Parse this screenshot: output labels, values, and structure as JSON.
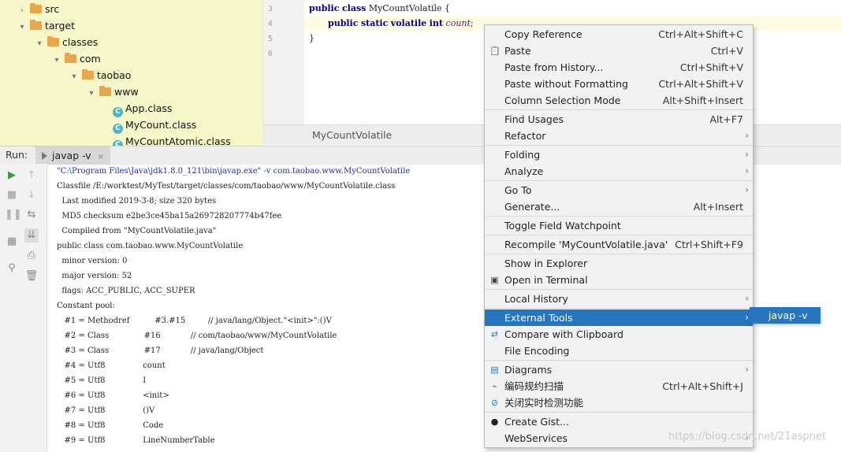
{
  "project_tree": {
    "items": [
      {
        "label": "src",
        "depth": 0,
        "expanded": false,
        "type": "folder"
      },
      {
        "label": "target",
        "depth": 0,
        "expanded": true,
        "type": "folder"
      },
      {
        "label": "classes",
        "depth": 1,
        "expanded": true,
        "type": "folder"
      },
      {
        "label": "com",
        "depth": 2,
        "expanded": true,
        "type": "folder"
      },
      {
        "label": "taobao",
        "depth": 3,
        "expanded": true,
        "type": "folder"
      },
      {
        "label": "www",
        "depth": 4,
        "expanded": true,
        "type": "folder"
      },
      {
        "label": "App.class",
        "depth": 5,
        "type": "class"
      },
      {
        "label": "MyCount.class",
        "depth": 5,
        "type": "class"
      },
      {
        "label": "MyCountAtomic.class",
        "depth": 5,
        "type": "class"
      }
    ]
  },
  "editor": {
    "line_numbers": [
      "3",
      "4",
      "5",
      "6"
    ],
    "line3": {
      "kw1": "public",
      "kw2": "class",
      "name": "MyCountVolatile {"
    },
    "line4": {
      "kw1": "public",
      "kw2": "static",
      "kw3": "volatile",
      "kw4": "int",
      "field": "count",
      "semi": ";"
    },
    "line5": "}",
    "breadcrumb": "MyCountVolatile"
  },
  "run_panel": {
    "label": "Run:",
    "tab_label": "javap -v",
    "tab_close": "×",
    "console_lines": [
      "\"C:\\Program Files\\Java\\jdk1.8.0_121\\bin\\javap.exe\" -v com.taobao.www.MyCountVolatile",
      "Classfile /E:/worktest/MyTest/target/classes/com/taobao/www/MyCountVolatile.class",
      "  Last modified 2019-3-8; size 320 bytes",
      "  MD5 checksum e2be3ce45ba15a269728207774b47fee",
      "  Compiled from \"MyCountVolatile.java\"",
      "public class com.taobao.www.MyCountVolatile",
      "  minor version: 0",
      "  major version: 52",
      "  flags: ACC_PUBLIC, ACC_SUPER",
      "Constant pool:",
      "   #1 = Methodref          #3.#15         // java/lang/Object.\"<init>\":()V",
      "   #2 = Class              #16            // com/taobao/www/MyCountVolatile",
      "   #3 = Class              #17            // java/lang/Object",
      "   #4 = Utf8               count",
      "   #5 = Utf8               I",
      "   #6 = Utf8               <init>",
      "   #7 = Utf8               ()V",
      "   #8 = Utf8               Code",
      "   #9 = Utf8               LineNumberTable"
    ]
  },
  "context_menu": {
    "items": [
      {
        "label": "Copy Reference",
        "shortcut": "Ctrl+Alt+Shift+C"
      },
      {
        "label": "Paste",
        "shortcut": "Ctrl+V",
        "icon": "paste-icon"
      },
      {
        "label": "Paste from History...",
        "shortcut": "Ctrl+Shift+V"
      },
      {
        "label": "Paste without Formatting",
        "shortcut": "Ctrl+Alt+Shift+V"
      },
      {
        "label": "Column Selection Mode",
        "shortcut": "Alt+Shift+Insert"
      },
      {
        "label": "Find Usages",
        "shortcut": "Alt+F7"
      },
      {
        "label": "Refactor",
        "submenu": true
      },
      {
        "label": "Folding",
        "submenu": true
      },
      {
        "label": "Analyze",
        "submenu": true
      },
      {
        "label": "Go To",
        "submenu": true
      },
      {
        "label": "Generate...",
        "shortcut": "Alt+Insert"
      },
      {
        "label": "Toggle Field Watchpoint"
      },
      {
        "label": "Recompile 'MyCountVolatile.java'",
        "shortcut": "Ctrl+Shift+F9"
      },
      {
        "label": "Show in Explorer"
      },
      {
        "label": "Open in Terminal",
        "icon": "terminal-icon"
      },
      {
        "label": "Local History",
        "submenu": true
      },
      {
        "label": "External Tools",
        "submenu": true,
        "selected": true
      },
      {
        "label": "Compare with Clipboard",
        "icon": "compare-icon"
      },
      {
        "label": "File Encoding"
      },
      {
        "label": "Diagrams",
        "submenu": true,
        "icon": "diagram-icon"
      },
      {
        "label": "编码规约扫描",
        "shortcut": "Ctrl+Alt+Shift+J",
        "icon": "scan-icon"
      },
      {
        "label": "关闭实时检测功能",
        "icon": "disable-icon"
      },
      {
        "label": "Create Gist...",
        "icon": "github-icon"
      },
      {
        "label": "WebServices",
        "submenu": true
      }
    ],
    "submenu_arrow": "›"
  },
  "external_tools_submenu": {
    "label": "javap -v"
  },
  "watermark": "https://blog.csdn.net/21aspnet",
  "colors": {
    "menu_selection": "#2675bf",
    "tree_bg": "#f6f7c8",
    "keyword": "#000080",
    "field": "#660e7a"
  }
}
